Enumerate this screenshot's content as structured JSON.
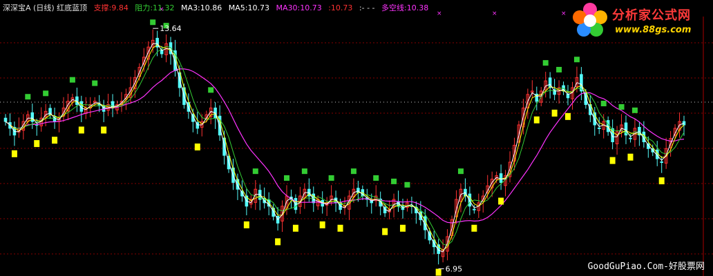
{
  "header": {
    "title": "深深宝A (日线) 红底蓝顶",
    "support_label": "支撑:",
    "support_value": "9.84",
    "resist_label": "阻力:",
    "resist_value": "11.32",
    "ma3": "MA3:10.86",
    "ma5": "MA5:10.73",
    "ma30": "MA30:10.73",
    "extra": ":10.73",
    "dashes": ":- - -",
    "duokong": "多空线:10.38"
  },
  "logo": {
    "title": "分析家公式网",
    "url": "www.88gs.com"
  },
  "footer": {
    "text": "GoodGuPiao.Com-好股票网"
  },
  "colors": {
    "up": "#ff3232",
    "down": "#54fcfc",
    "ma_white": "#ffffff",
    "ma_yellow": "#ffff00",
    "ma_green": "#33cc33",
    "ma_magenta": "#ff33ff",
    "green_marker": "#33cc33",
    "yellow_marker": "#ffff00",
    "grid": "#880000"
  },
  "chart_data": {
    "type": "candlestick",
    "period": "日线",
    "y_range": [
      6.6,
      14.1
    ],
    "high_annotation": "13.64",
    "low_annotation": "6.95",
    "closes": [
      11.0,
      10.8,
      10.6,
      10.8,
      11.0,
      11.2,
      11.0,
      10.9,
      11.1,
      11.3,
      11.2,
      11.0,
      11.1,
      11.4,
      11.6,
      11.7,
      11.5,
      11.3,
      11.4,
      11.5,
      11.6,
      11.5,
      11.3,
      11.5,
      11.4,
      11.5,
      11.6,
      11.8,
      12.0,
      12.3,
      12.6,
      12.9,
      13.2,
      13.4,
      13.2,
      13.0,
      13.3,
      13.0,
      12.5,
      12.0,
      11.5,
      11.3,
      11.0,
      10.8,
      11.0,
      11.2,
      11.4,
      11.1,
      10.6,
      10.0,
      9.6,
      9.2,
      9.0,
      8.8,
      8.5,
      8.7,
      9.0,
      8.7,
      8.6,
      8.5,
      8.2,
      8.0,
      8.5,
      8.8,
      8.7,
      8.4,
      8.8,
      9.0,
      8.8,
      8.6,
      8.7,
      8.5,
      8.6,
      8.8,
      8.6,
      8.4,
      8.5,
      8.8,
      9.0,
      8.9,
      8.8,
      8.7,
      8.6,
      8.8,
      8.5,
      8.3,
      8.4,
      8.7,
      8.5,
      8.4,
      8.6,
      8.5,
      8.3,
      8.1,
      7.8,
      7.5,
      7.3,
      7.1,
      7.2,
      7.6,
      8.1,
      8.7,
      9.0,
      8.8,
      8.5,
      8.4,
      8.6,
      8.8,
      9.1,
      9.3,
      9.4,
      9.2,
      9.4,
      9.8,
      10.3,
      10.9,
      11.4,
      11.8,
      11.9,
      11.6,
      11.9,
      12.2,
      12.0,
      11.8,
      12.0,
      11.9,
      11.7,
      12.0,
      12.3,
      11.9,
      11.5,
      11.2,
      10.9,
      10.8,
      11.0,
      10.7,
      10.4,
      10.7,
      10.9,
      10.6,
      10.5,
      10.8,
      10.6,
      10.4,
      10.2,
      10.1,
      9.9,
      9.8,
      10.2,
      10.5,
      10.8,
      11.0,
      10.9
    ]
  }
}
